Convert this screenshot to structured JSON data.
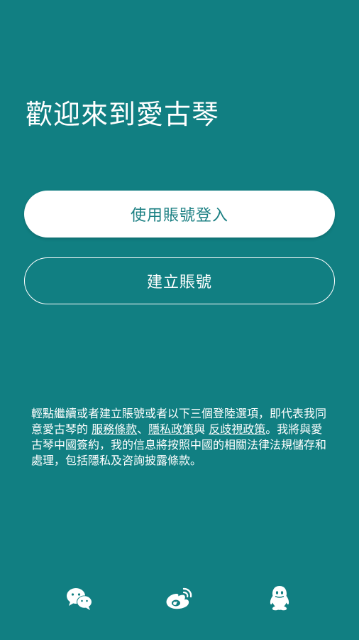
{
  "welcome": {
    "title": "歡迎來到愛古琴"
  },
  "buttons": {
    "login_label": "使用賬號登入",
    "create_label": "建立賬號"
  },
  "terms": {
    "prefix": "輕點繼續或者建立賬號或者以下三個登陸選項，即代表我同意愛古琴的 ",
    "link_service": "服務條款",
    "sep1": "、",
    "link_privacy": "隱私政策",
    "sep2": "與 ",
    "link_anti": "反歧視政策",
    "suffix": "。我將與愛古琴中國簽約，我的信息將按照中國的相關法律法規儲存和處理，包括隱私及咨詢披露條款。"
  },
  "social": {
    "icons": [
      "wechat-icon",
      "weibo-icon",
      "qq-icon"
    ]
  },
  "colors": {
    "background": "#117f82",
    "accent_text": "#1a7f82",
    "white": "#ffffff"
  }
}
